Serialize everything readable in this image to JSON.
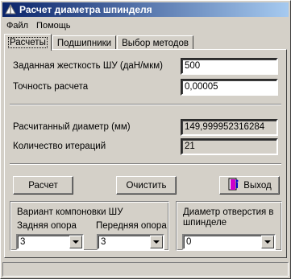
{
  "window": {
    "title": "Расчет диаметра шпинделя"
  },
  "menu": {
    "items": [
      "Файл",
      "Помощь"
    ]
  },
  "tabs": [
    {
      "label": "Расчеты",
      "active": true
    },
    {
      "label": "Подшипники",
      "active": false
    },
    {
      "label": "Выбор методов",
      "active": false
    }
  ],
  "inputs": {
    "stiffness": {
      "label": "Заданная жесткость ШУ (даН/мкм)",
      "value": "500"
    },
    "precision": {
      "label": "Точность расчета",
      "value": "0,00005"
    }
  },
  "results": {
    "diameter": {
      "label": "Расчитанный диаметр (мм)",
      "value": "149,999952316284"
    },
    "iterations": {
      "label": "Количество итераций",
      "value": "21"
    }
  },
  "buttons": {
    "calculate": "Расчет",
    "clear": "Очистить",
    "exit": "Выход"
  },
  "layout_group": {
    "title": "Вариант компоновки ШУ",
    "rear_support": {
      "label": "Задняя опора",
      "value": "3"
    },
    "front_support": {
      "label": "Передняя опора",
      "value": "3"
    }
  },
  "bore_group": {
    "label_line1": "Диаметр отверстия в",
    "label_line2": "шпинделе",
    "value": "0"
  },
  "icons": {
    "app": "spindle-app-icon",
    "exit": "exit-door-icon",
    "dropdown": "chevron-down-icon"
  }
}
